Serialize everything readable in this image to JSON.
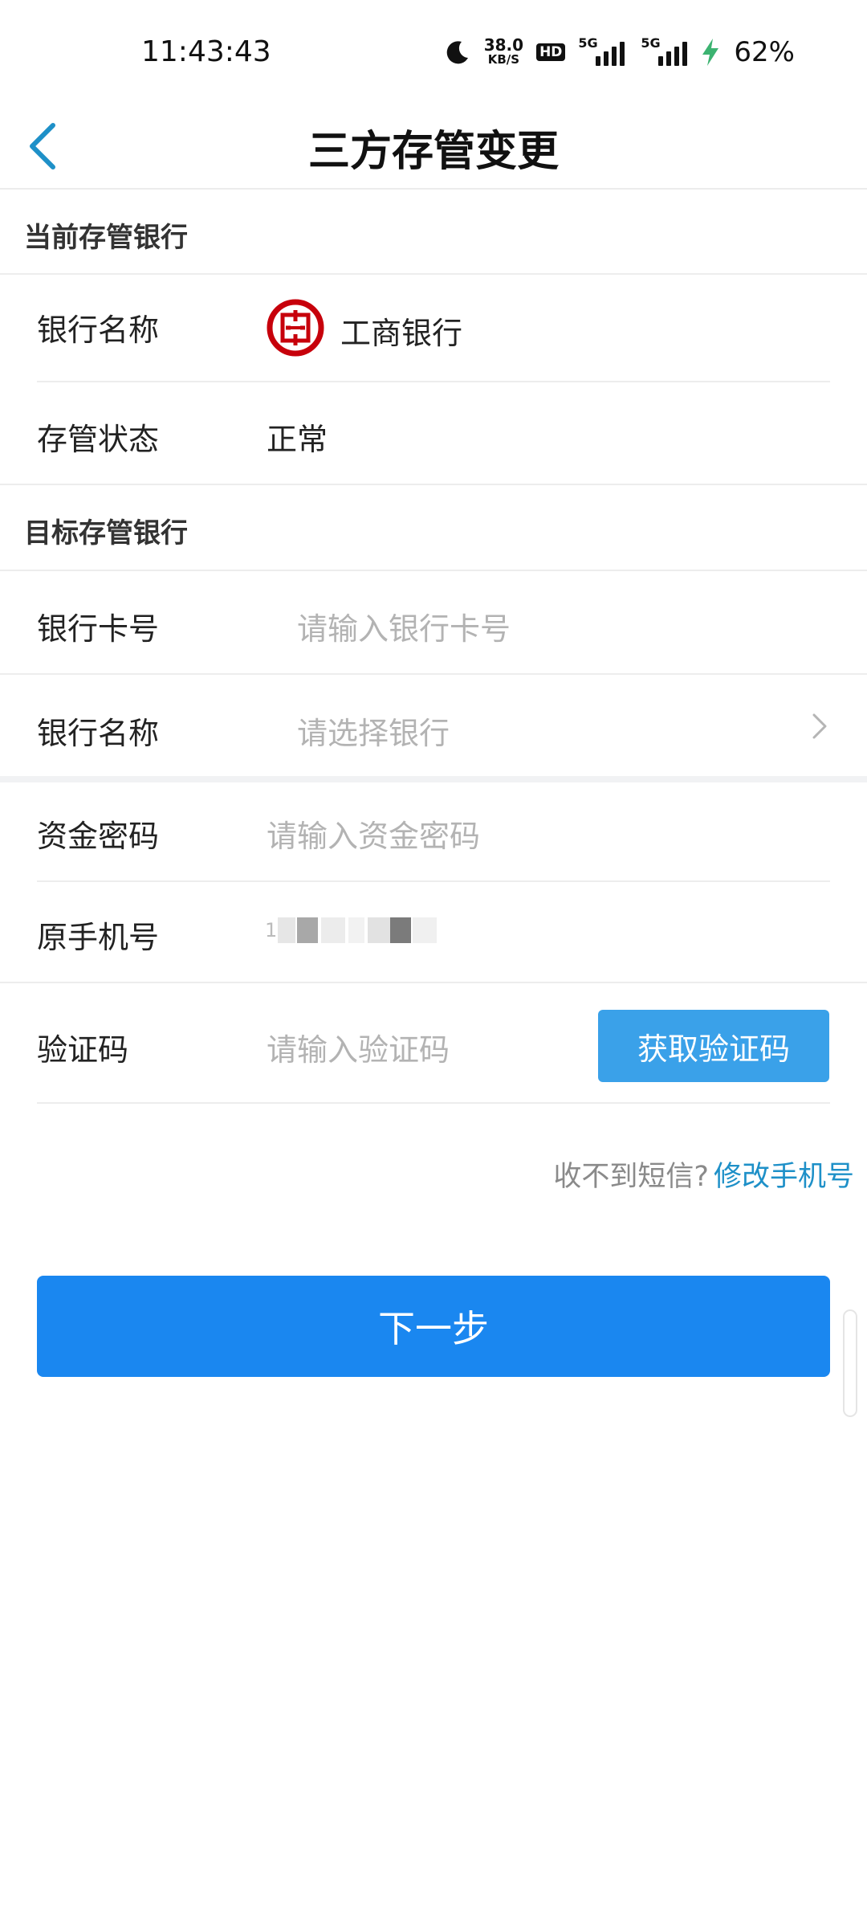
{
  "status_bar": {
    "time": "11:43:43",
    "net_speed": "38.0",
    "net_unit": "KB/S",
    "hd": "HD",
    "sig1": "5G",
    "sig2": "5G",
    "battery": "62%",
    "icons": [
      "moon-icon",
      "hd-icon",
      "signal-icon",
      "signal-icon",
      "charging-icon"
    ]
  },
  "header": {
    "title": "三方存管变更"
  },
  "current_section": {
    "title": "当前存管银行",
    "bank_name_label": "银行名称",
    "bank_name_value": "工商银行",
    "status_label": "存管状态",
    "status_value": "正常"
  },
  "target_section": {
    "title": "目标存管银行",
    "card_label": "银行卡号",
    "card_placeholder": "请输入银行卡号",
    "bank_label": "银行名称",
    "bank_placeholder": "请选择银行"
  },
  "verify": {
    "fund_pwd_label": "资金密码",
    "fund_pwd_placeholder": "请输入资金密码",
    "phone_label": "原手机号",
    "phone_value_partial": "1",
    "code_label": "验证码",
    "code_placeholder": "请输入验证码",
    "get_code_button": "获取验证码"
  },
  "sms_hint": {
    "question": "收不到短信?",
    "link": "修改手机号"
  },
  "next_button": "下一步",
  "colors": {
    "accent": "#1a87f0",
    "code_button": "#3aa1e9",
    "link": "#1e90c8",
    "icbc_red": "#c7000b"
  }
}
